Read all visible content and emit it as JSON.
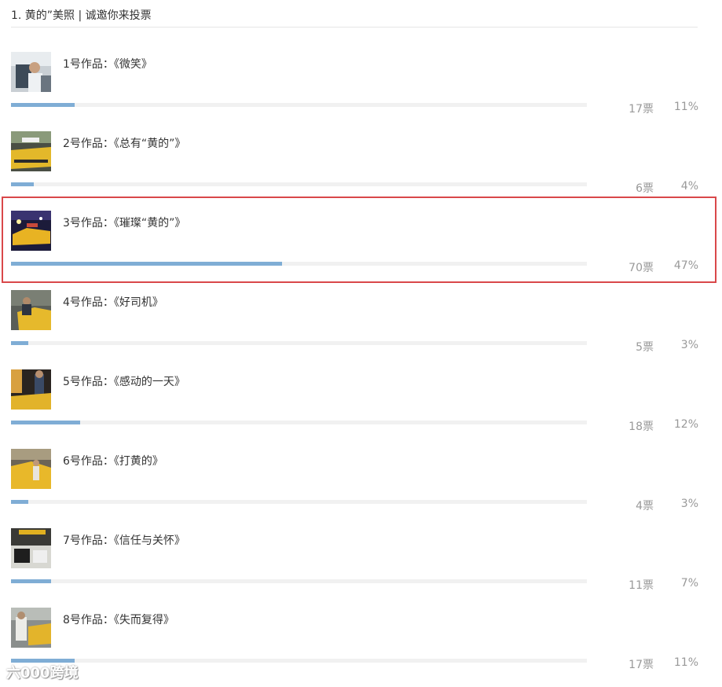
{
  "poll": {
    "title": "1. 黄的”美照 | 诚邀你来投票"
  },
  "options": [
    {
      "label": "1号作品：《微笑》",
      "votes": "17票",
      "percent": "11%",
      "fill": 0.11
    },
    {
      "label": "2号作品：《总有“黄的”》",
      "votes": "6票",
      "percent": "4%",
      "fill": 0.04
    },
    {
      "label": "3号作品：《璀璨“黄的”》",
      "votes": "70票",
      "percent": "47%",
      "fill": 0.47
    },
    {
      "label": "4号作品：《好司机》",
      "votes": "5票",
      "percent": "3%",
      "fill": 0.03
    },
    {
      "label": "5号作品：《感动的一天》",
      "votes": "18票",
      "percent": "12%",
      "fill": 0.12
    },
    {
      "label": "6号作品：《打黄的》",
      "votes": "4票",
      "percent": "3%",
      "fill": 0.03
    },
    {
      "label": "7号作品：《信任与关怀》",
      "votes": "11票",
      "percent": "7%",
      "fill": 0.07
    },
    {
      "label": "8号作品：《失而复得》",
      "votes": "17票",
      "percent": "11%",
      "fill": 0.11
    }
  ],
  "highlighted_option": 3,
  "colors": {
    "bar_fill": "#7fadd5",
    "bar_track": "#f1f1f1",
    "highlight_border": "#d9484a",
    "muted_text": "#999999"
  },
  "watermark": {
    "text": "六000跨境"
  }
}
